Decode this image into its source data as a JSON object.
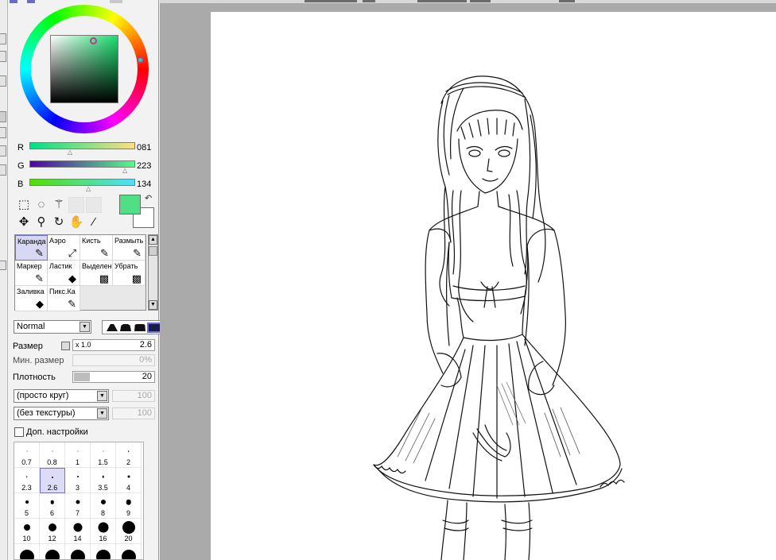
{
  "color": {
    "accent": "#51df86",
    "rgb": [
      {
        "label": "R",
        "value": "081",
        "fraction": 0.32
      },
      {
        "label": "G",
        "value": "223",
        "fraction": 0.87
      },
      {
        "label": "B",
        "value": "134",
        "fraction": 0.53
      }
    ]
  },
  "selection_tools": [
    {
      "name": "rect-select-icon",
      "glyph": "⬚"
    },
    {
      "name": "lasso-icon",
      "glyph": "◌"
    },
    {
      "name": "magic-wand-icon",
      "glyph": "⚚"
    },
    {
      "name": "move-icon",
      "glyph": "✥"
    },
    {
      "name": "zoom-icon",
      "glyph": "⚲"
    },
    {
      "name": "rotate-icon",
      "glyph": "↻"
    },
    {
      "name": "hand-icon",
      "glyph": "✋"
    },
    {
      "name": "eyedropper-icon",
      "glyph": "⁄"
    }
  ],
  "brushes": [
    {
      "label": "Каранда",
      "icon": "✎",
      "selected": true
    },
    {
      "label": "Аэро",
      "icon": "⤢",
      "selected": false
    },
    {
      "label": "Кисть",
      "icon": "✎",
      "selected": false
    },
    {
      "label": "Размыть",
      "icon": "✎",
      "selected": false
    },
    {
      "label": "Маркер",
      "icon": "✎",
      "selected": false
    },
    {
      "label": "Ластик",
      "icon": "◆",
      "selected": false
    },
    {
      "label": "Выделен",
      "icon": "▩",
      "selected": false
    },
    {
      "label": "Убрать",
      "icon": "▩",
      "selected": false
    },
    {
      "label": "Заливка",
      "icon": "◆",
      "selected": false
    },
    {
      "label": "Пикс.Ка",
      "icon": "✎",
      "selected": false
    }
  ],
  "blend_mode": "Normal",
  "size": {
    "label": "Размер",
    "multiplier": "x 1.0",
    "value": "2.6"
  },
  "min_size": {
    "label": "Мин. размер",
    "value": "0%"
  },
  "density": {
    "label": "Плотность",
    "value": "20",
    "fraction": 0.2
  },
  "shape_select": {
    "value": "(просто круг)",
    "amount": "100"
  },
  "texture_select": {
    "value": "(без текстуры)",
    "amount": "100"
  },
  "advanced": {
    "label": "Доп. настройки"
  },
  "brush_sizes": [
    {
      "label": "0.7",
      "size": 1
    },
    {
      "label": "0.8",
      "size": 1
    },
    {
      "label": "1",
      "size": 1
    },
    {
      "label": "1.5",
      "size": 1
    },
    {
      "label": "2",
      "size": 1.5
    },
    {
      "label": "2.3",
      "size": 1.5
    },
    {
      "label": "2.6",
      "size": 2,
      "selected": true
    },
    {
      "label": "3",
      "size": 2
    },
    {
      "label": "3.5",
      "size": 2.5
    },
    {
      "label": "4",
      "size": 3
    },
    {
      "label": "5",
      "size": 4
    },
    {
      "label": "6",
      "size": 4.5
    },
    {
      "label": "7",
      "size": 5
    },
    {
      "label": "8",
      "size": 6
    },
    {
      "label": "9",
      "size": 6.5
    },
    {
      "label": "10",
      "size": 8
    },
    {
      "label": "12",
      "size": 10
    },
    {
      "label": "14",
      "size": 11
    },
    {
      "label": "16",
      "size": 13
    },
    {
      "label": "20",
      "size": 16
    },
    {
      "label": "",
      "size": 18
    },
    {
      "label": "",
      "size": 18
    },
    {
      "label": "",
      "size": 18
    },
    {
      "label": "",
      "size": 18
    },
    {
      "label": "",
      "size": 18
    }
  ]
}
